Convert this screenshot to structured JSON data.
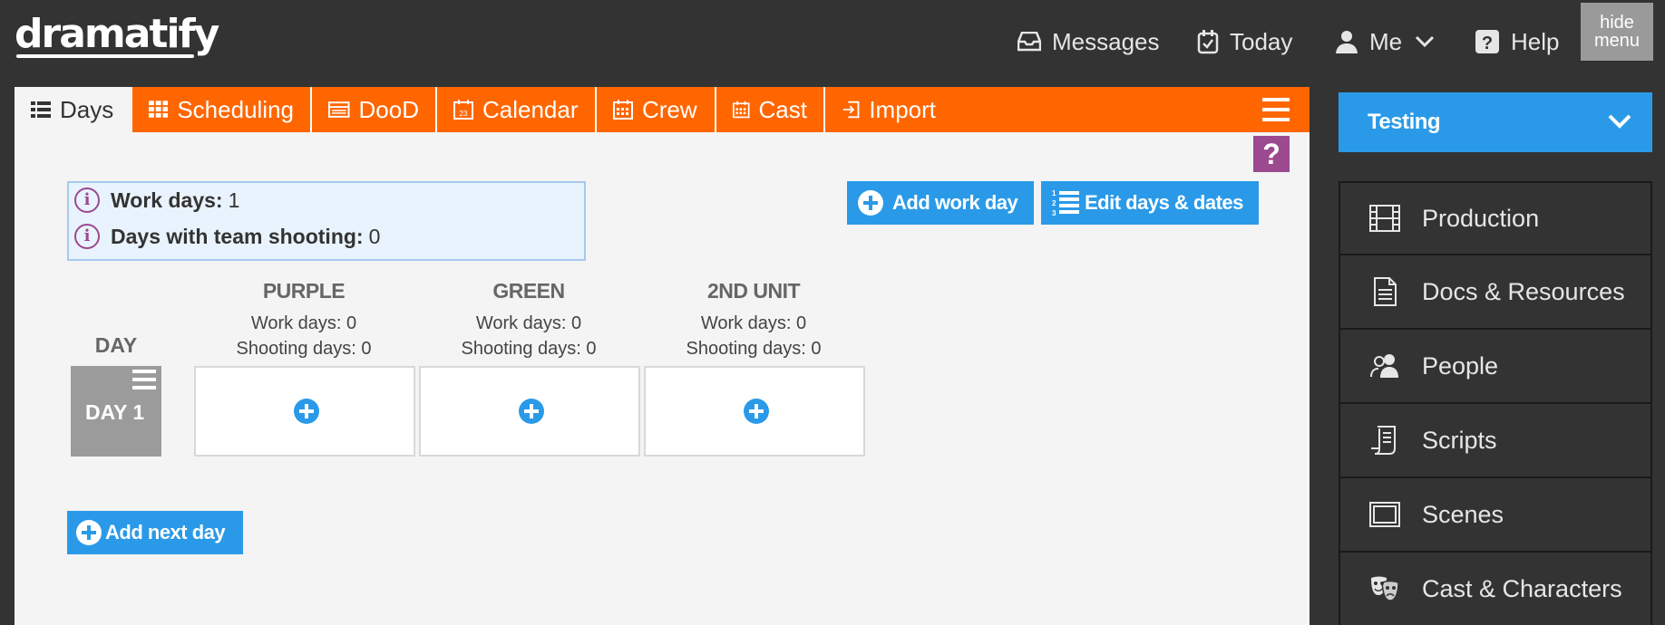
{
  "app": {
    "logo": "dramatify"
  },
  "topnav": {
    "messages": "Messages",
    "today": "Today",
    "me": "Me",
    "help": "Help",
    "hide_menu_line1": "hide",
    "hide_menu_line2": "menu"
  },
  "tabs": [
    {
      "label": "Days",
      "icon": "list-icon",
      "active": true
    },
    {
      "label": "Scheduling",
      "icon": "grid-icon"
    },
    {
      "label": "DooD",
      "icon": "table-icon"
    },
    {
      "label": "Calendar",
      "icon": "calendar-icon"
    },
    {
      "label": "Crew",
      "icon": "calendar-icon"
    },
    {
      "label": "Cast",
      "icon": "calendar-icon"
    },
    {
      "label": "Import",
      "icon": "import-icon"
    }
  ],
  "help_button": "?",
  "info": {
    "work_days_label": "Work days:",
    "work_days_value": "1",
    "team_shooting_label": "Days with team shooting:",
    "team_shooting_value": "0"
  },
  "actions": {
    "add_work_day": "Add work day",
    "edit_days": "Edit days & dates",
    "add_next_day": "Add next day"
  },
  "grid": {
    "day_header": "DAY",
    "units": [
      {
        "name": "PURPLE",
        "work_days": "Work days: 0",
        "shooting_days": "Shooting days: 0"
      },
      {
        "name": "GREEN",
        "work_days": "Work days: 0",
        "shooting_days": "Shooting days: 0"
      },
      {
        "name": "2ND UNIT",
        "work_days": "Work days: 0",
        "shooting_days": "Shooting days: 0"
      }
    ],
    "days": [
      {
        "label": "DAY 1"
      }
    ]
  },
  "sidebar": {
    "project": "Testing",
    "items": [
      {
        "label": "Production",
        "icon": "film-icon"
      },
      {
        "label": "Docs & Resources",
        "icon": "document-icon"
      },
      {
        "label": "People",
        "icon": "people-icon"
      },
      {
        "label": "Scripts",
        "icon": "script-icon"
      },
      {
        "label": "Scenes",
        "icon": "scenes-icon"
      },
      {
        "label": "Cast & Characters",
        "icon": "masks-icon"
      }
    ]
  },
  "colors": {
    "topbar": "#333333",
    "tabbar": "#ff6600",
    "accent_blue": "#2a9ae8",
    "help_purple": "#9c4a90",
    "day_cell": "#9b9b9b"
  }
}
